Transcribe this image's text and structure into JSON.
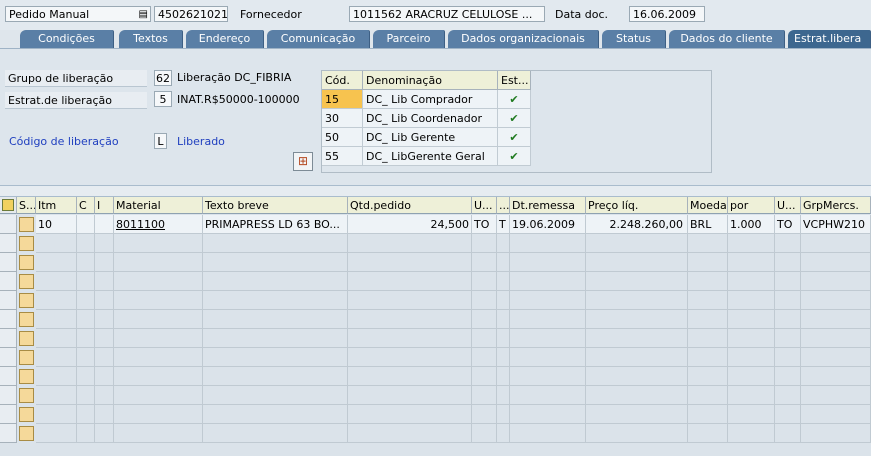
{
  "header": {
    "doc_type": "Pedido Manual",
    "doc_number": "4502621021",
    "supplier_label": "Fornecedor",
    "supplier_value": "1011562 ARACRUZ CELULOSE ...",
    "date_label": "Data doc.",
    "date_value": "16.06.2009"
  },
  "tabs": [
    "Condições",
    "Textos",
    "Endereço",
    "Comunicação",
    "Parceiro",
    "Dados organizacionais",
    "Status",
    "Dados do cliente",
    "Estrat.libera"
  ],
  "release": {
    "group_label": "Grupo de liberação",
    "group_code": "62",
    "group_text": "Liberação DC_FIBRIA",
    "strategy_label": "Estrat.de liberação",
    "strategy_code": "5",
    "strategy_text": "INAT.R$50000-100000",
    "code_label": "Código de liberação",
    "code_value": "L",
    "code_text": "Liberado",
    "table_headers": [
      "Cód.",
      "Denominação",
      "Est..."
    ],
    "table_rows": [
      {
        "cod": "15",
        "denom": "DC_ Lib Comprador",
        "status": "✔"
      },
      {
        "cod": "30",
        "denom": "DC_ Lib Coordenador",
        "status": "✔"
      },
      {
        "cod": "50",
        "denom": "DC_ Lib Gerente",
        "status": "✔"
      },
      {
        "cod": "55",
        "denom": "DC_ LibGerente Geral",
        "status": "✔"
      }
    ]
  },
  "items": {
    "headers": [
      "S...",
      "Itm",
      "C",
      "I",
      "Material",
      "Texto breve",
      "Qtd.pedido",
      "U...",
      "...",
      "Dt.remessa",
      "Preço líq.",
      "Moeda",
      "por",
      "U...",
      "GrpMercs."
    ],
    "rows": [
      {
        "itm": "10",
        "c": "",
        "i": "",
        "material": "8011100",
        "texto": "PRIMAPRESS LD 63 BO...",
        "qtd": "24,500",
        "un": "TO",
        "t": "T",
        "dt": "19.06.2009",
        "preco": "2.248.260,00",
        "moeda": "BRL",
        "por": "1.000",
        "u2": "TO",
        "grp": "VCPHW210"
      }
    ]
  },
  "colors": {
    "tab": "#5a7fa6",
    "active_tab": "#3d678f",
    "header_cell": "#eef0d8",
    "selected_code": "#f7c34f"
  }
}
